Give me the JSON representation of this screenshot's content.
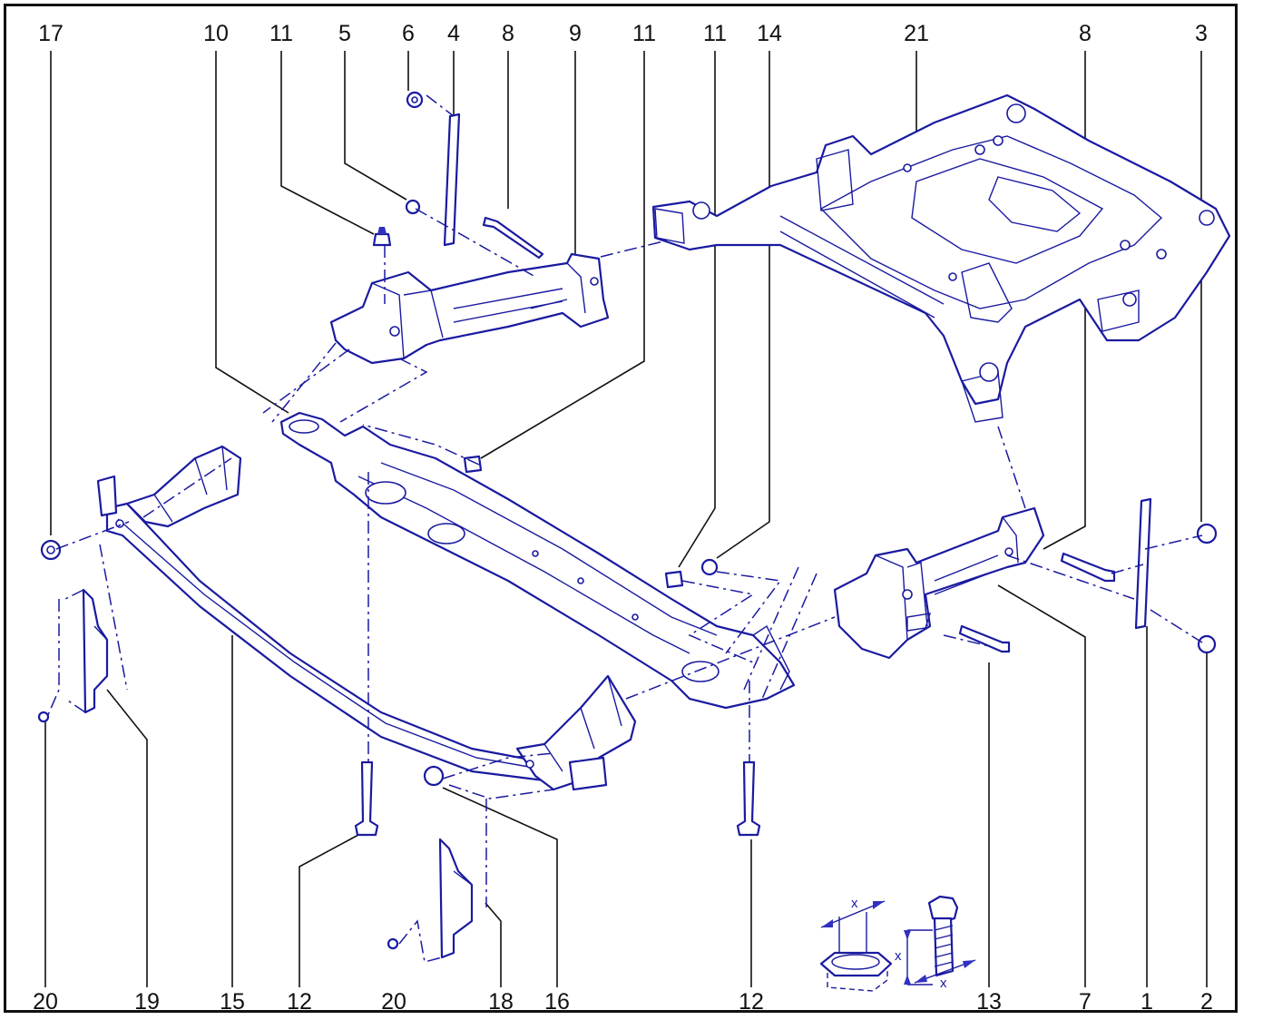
{
  "diagram": {
    "callouts_top": [
      "17",
      "10",
      "11",
      "5",
      "6",
      "4",
      "8",
      "9",
      "11",
      "11",
      "14",
      "21",
      "8",
      "3"
    ],
    "callouts_bottom": [
      "20",
      "19",
      "15",
      "12",
      "20",
      "18",
      "16",
      "12",
      "13",
      "7",
      "1",
      "2"
    ],
    "dimension_labels": [
      "x",
      "x",
      "x"
    ],
    "colors": {
      "line_art": "#1a1aa0",
      "callouts": "#111111",
      "background": "#ffffff"
    }
  }
}
